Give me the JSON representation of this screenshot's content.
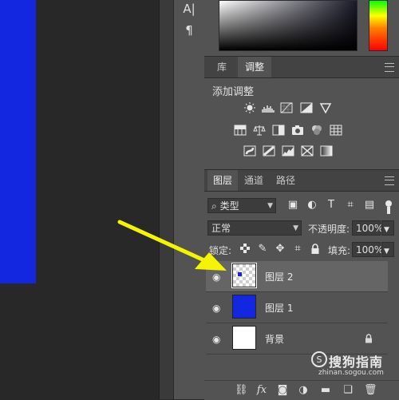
{
  "tool_strip": {
    "icons": [
      "character-panel-icon",
      "paragraph-panel-icon"
    ]
  },
  "adjustments_panel": {
    "tabs": [
      "库",
      "调整"
    ],
    "active_tab": "调整",
    "title": "添加调整"
  },
  "layers_panel": {
    "tabs": [
      "图层",
      "通道",
      "路径"
    ],
    "active_tab": "图层",
    "filter_kind": "类型",
    "blend_mode": "正常",
    "opacity_label": "不透明度:",
    "opacity_value": "100%",
    "lock_label": "锁定:",
    "fill_label": "填充:",
    "fill_value": "100%",
    "layers": [
      {
        "name": "图层 2",
        "selected": true,
        "thumb": "transparent-with-blue-dot"
      },
      {
        "name": "图层 1",
        "selected": false,
        "thumb": "solid-blue"
      },
      {
        "name": "背景",
        "selected": false,
        "thumb": "white",
        "locked": true
      }
    ]
  },
  "watermark": {
    "cn": "搜狗指南",
    "url": "zhinan.sogou.com"
  },
  "colors": {
    "canvas_blue": "#1427e0",
    "arrow_yellow": "#f5f500",
    "panel_bg": "#535353"
  }
}
